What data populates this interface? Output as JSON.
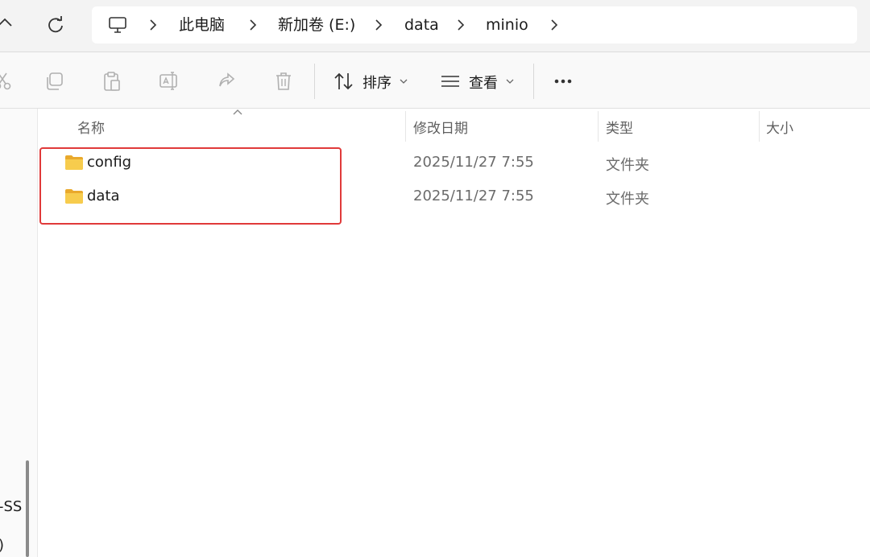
{
  "breadcrumb": {
    "items": [
      {
        "label": "此电脑"
      },
      {
        "label": "新加卷 (E:)"
      },
      {
        "label": "data"
      },
      {
        "label": "minio"
      }
    ]
  },
  "toolbar": {
    "icons": [
      "cut-icon",
      "copy-icon",
      "paste-icon",
      "rename-icon",
      "share-icon",
      "delete-icon"
    ],
    "sort_label": "排序",
    "view_label": "查看"
  },
  "columns": {
    "name": "名称",
    "date": "修改日期",
    "type": "类型",
    "size": "大小"
  },
  "files": [
    {
      "name": "config",
      "date": "2025/11/27 7:55",
      "type": "文件夹"
    },
    {
      "name": "data",
      "date": "2025/11/27 7:55",
      "type": "文件夹"
    }
  ],
  "left_pane": {
    "fragments": [
      "-SS",
      ")"
    ]
  },
  "colors": {
    "highlight": "#e03a3a",
    "folder": "#f4c242"
  }
}
